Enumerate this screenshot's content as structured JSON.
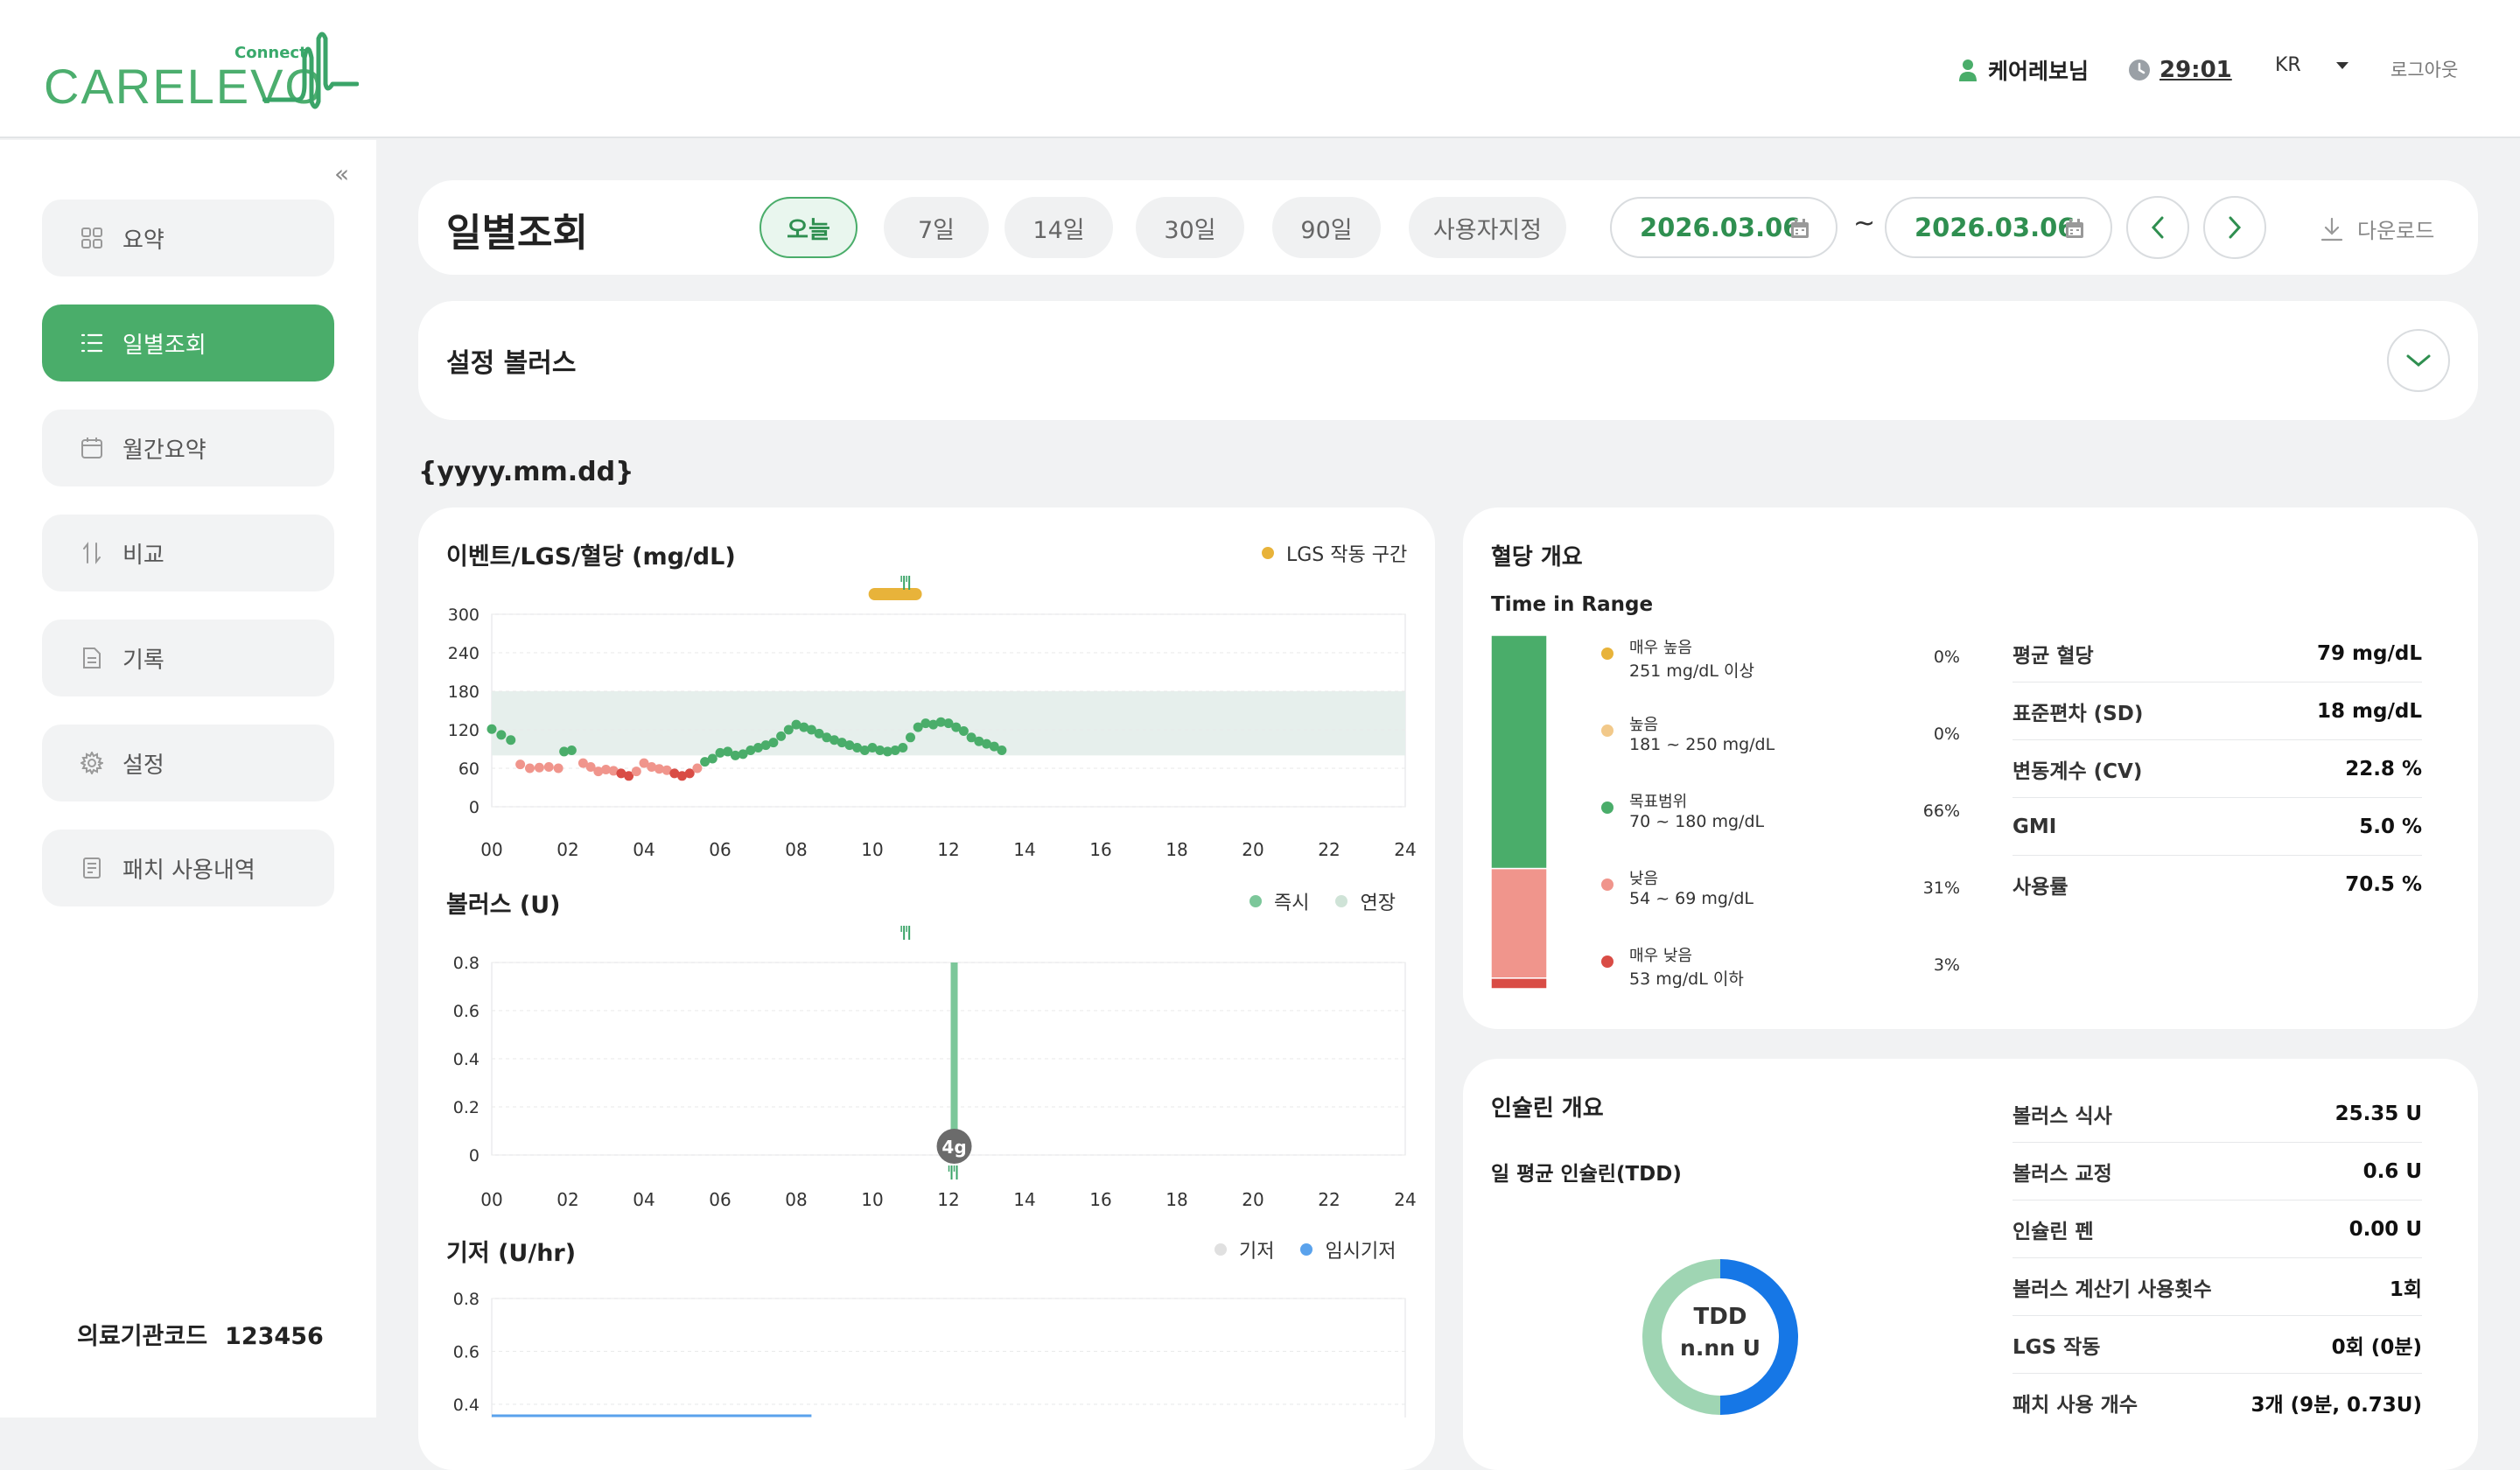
{
  "header": {
    "logo_sub": "Connect",
    "logo_text": "CARELEVO",
    "user_name": "케어레보님",
    "timer": "29:01",
    "language": "KR",
    "logout": "로그아웃"
  },
  "sidebar": {
    "collapse": "«",
    "items": [
      {
        "label": "요약",
        "icon": "grid-icon"
      },
      {
        "label": "일별조회",
        "icon": "list-icon",
        "active": true
      },
      {
        "label": "월간요약",
        "icon": "calendar-icon"
      },
      {
        "label": "비교",
        "icon": "compare-icon"
      },
      {
        "label": "기록",
        "icon": "document-icon"
      },
      {
        "label": "설정",
        "icon": "gear-icon"
      },
      {
        "label": "패치 사용내역",
        "icon": "receipt-icon"
      }
    ],
    "org_label": "의료기관코드",
    "org_code": "123456"
  },
  "toolbar": {
    "title": "일별조회",
    "ranges": [
      "오늘",
      "7일",
      "14일",
      "30일",
      "90일",
      "사용자지정"
    ],
    "selected_range": "오늘",
    "date_from": "2026.03.06",
    "date_sep": "~",
    "date_to": "2026.03.06",
    "download": "다운로드"
  },
  "bolus_settings": {
    "title": "설정 볼러스"
  },
  "date_placeholder": "{yyyy.mm.dd}",
  "colors": {
    "accent": "#4aad6a",
    "veryHigh": "#e8b33a",
    "high": "#f2c98a",
    "target": "#4aad6a",
    "low": "#f0958c",
    "veryLow": "#d94c45",
    "lgs": "#e8b33a",
    "instant": "#7cc79a",
    "extended": "#cfe3d7",
    "basal": "#e0e0e0",
    "temp_basal": "#5aa2ec"
  },
  "charts": {
    "glucose": {
      "title": "이벤트/LGS/혈당 (mg/dL)",
      "legend": "LGS 작동 구간"
    },
    "bolus": {
      "title": "볼러스 (U)",
      "legend_instant": "즉시",
      "legend_extended": "연장",
      "carb_label": "4g"
    },
    "basal": {
      "title": "기저 (U/hr)",
      "legend_basal": "기저",
      "legend_temp": "임시기저"
    }
  },
  "chart_data": [
    {
      "type": "scatter",
      "title": "이벤트/LGS/혈당 (mg/dL)",
      "x_ticks": [
        "00",
        "02",
        "04",
        "06",
        "08",
        "10",
        "12",
        "14",
        "16",
        "18",
        "20",
        "22",
        "24"
      ],
      "y_ticks": [
        "0",
        "60",
        "120",
        "180",
        "240",
        "300"
      ],
      "xlim": [
        0,
        24
      ],
      "ylim": [
        0,
        300
      ],
      "target_range": [
        80,
        180
      ],
      "lgs_interval": [
        9.9,
        11.3
      ],
      "meal_events_h": [
        10.9
      ],
      "points": [
        [
          0.0,
          121
        ],
        [
          0.25,
          112
        ],
        [
          0.5,
          104
        ],
        [
          0.75,
          66
        ],
        [
          1.0,
          60
        ],
        [
          1.25,
          61
        ],
        [
          1.5,
          62
        ],
        [
          1.75,
          60
        ],
        [
          1.9,
          86
        ],
        [
          2.1,
          88
        ],
        [
          2.4,
          68
        ],
        [
          2.6,
          62
        ],
        [
          2.8,
          55
        ],
        [
          3.0,
          58
        ],
        [
          3.2,
          56
        ],
        [
          3.4,
          52
        ],
        [
          3.6,
          48
        ],
        [
          3.8,
          55
        ],
        [
          4.0,
          68
        ],
        [
          4.2,
          62
        ],
        [
          4.4,
          59
        ],
        [
          4.6,
          57
        ],
        [
          4.8,
          52
        ],
        [
          5.0,
          48
        ],
        [
          5.2,
          52
        ],
        [
          5.4,
          60
        ],
        [
          5.6,
          70
        ],
        [
          5.8,
          75
        ],
        [
          6.0,
          84
        ],
        [
          6.2,
          86
        ],
        [
          6.4,
          80
        ],
        [
          6.6,
          82
        ],
        [
          6.8,
          88
        ],
        [
          7.0,
          92
        ],
        [
          7.2,
          96
        ],
        [
          7.4,
          100
        ],
        [
          7.6,
          110
        ],
        [
          7.8,
          120
        ],
        [
          8.0,
          128
        ],
        [
          8.2,
          124
        ],
        [
          8.4,
          120
        ],
        [
          8.6,
          114
        ],
        [
          8.8,
          108
        ],
        [
          9.0,
          104
        ],
        [
          9.2,
          100
        ],
        [
          9.4,
          96
        ],
        [
          9.6,
          92
        ],
        [
          9.8,
          88
        ],
        [
          10.0,
          92
        ],
        [
          10.2,
          88
        ],
        [
          10.4,
          86
        ],
        [
          10.6,
          88
        ],
        [
          10.8,
          92
        ],
        [
          11.0,
          108
        ],
        [
          11.2,
          124
        ],
        [
          11.4,
          130
        ],
        [
          11.6,
          128
        ],
        [
          11.8,
          132
        ],
        [
          12.0,
          130
        ],
        [
          12.2,
          124
        ],
        [
          12.4,
          118
        ],
        [
          12.6,
          108
        ],
        [
          12.8,
          102
        ],
        [
          13.0,
          98
        ],
        [
          13.2,
          94
        ],
        [
          13.4,
          88
        ]
      ]
    },
    {
      "type": "bar",
      "title": "볼러스 (U)",
      "x_ticks": [
        "00",
        "02",
        "04",
        "06",
        "08",
        "10",
        "12",
        "14",
        "16",
        "18",
        "20",
        "22",
        "24"
      ],
      "y_ticks": [
        "0",
        "0.2",
        "0.4",
        "0.6",
        "0.8"
      ],
      "xlim": [
        0,
        24
      ],
      "ylim": [
        0,
        0.8
      ],
      "series": [
        {
          "name": "즉시",
          "x": [
            12.15
          ],
          "values": [
            0.8
          ]
        },
        {
          "name": "연장",
          "x": [],
          "values": []
        }
      ],
      "carb_event": {
        "x": 12.15,
        "label": "4g"
      },
      "meal_events_h": [
        10.9
      ]
    },
    {
      "type": "line",
      "title": "기저 (U/hr)",
      "y_ticks": [
        "0.4",
        "0.6",
        "0.8"
      ],
      "ylim": [
        0.4,
        0.8
      ],
      "series": [
        {
          "name": "기저",
          "x": [],
          "values": []
        },
        {
          "name": "임시기저",
          "x": [],
          "values": []
        }
      ]
    }
  ],
  "bg_overview": {
    "title": "혈당 개요",
    "tir_title": "Time in Range",
    "tir": [
      {
        "name": "매우 높음",
        "range": "251 mg/dL 이상",
        "pct": "0%",
        "value": 0,
        "color": "#e8b33a"
      },
      {
        "name": "높음",
        "range": "181 ~ 250 mg/dL",
        "pct": "0%",
        "value": 0,
        "color": "#f2c98a"
      },
      {
        "name": "목표범위",
        "range": "70 ~ 180 mg/dL",
        "pct": "66%",
        "value": 66,
        "color": "#4aad6a"
      },
      {
        "name": "낮음",
        "range": "54 ~ 69 mg/dL",
        "pct": "31%",
        "value": 31,
        "color": "#f0958c"
      },
      {
        "name": "매우 낮음",
        "range": "53 mg/dL 이하",
        "pct": "3%",
        "value": 3,
        "color": "#d94c45"
      }
    ],
    "stats": [
      {
        "label": "평균 혈당",
        "value": "79 mg/dL"
      },
      {
        "label": "표준편차 (SD)",
        "value": "18 mg/dL"
      },
      {
        "label": "변동계수 (CV)",
        "value": "22.8 %"
      },
      {
        "label": "GMI",
        "value": "5.0 %"
      },
      {
        "label": "사용률",
        "value": "70.5 %"
      }
    ]
  },
  "insulin_overview": {
    "title": "인슐린 개요",
    "tdd_title": "일 평균 인슐린(TDD)",
    "tdd_label": "TDD",
    "tdd_value": "n.nn U",
    "tdd_split": [
      {
        "name": "bolus",
        "value": 50,
        "color": "#1677e6"
      },
      {
        "name": "basal",
        "value": 50,
        "color": "#9fd5b3"
      }
    ],
    "stats": [
      {
        "label": "볼러스 식사",
        "value": "25.35 U"
      },
      {
        "label": "볼러스 교정",
        "value": "0.6 U"
      },
      {
        "label": "인슐린 펜",
        "value": "0.00 U"
      },
      {
        "label": "볼러스 계산기 사용횟수",
        "value": "1회"
      },
      {
        "label": "LGS 작동",
        "value": "0회 (0분)"
      },
      {
        "label": "패치 사용 개수",
        "value": "3개 (9분, 0.73U)"
      }
    ]
  }
}
